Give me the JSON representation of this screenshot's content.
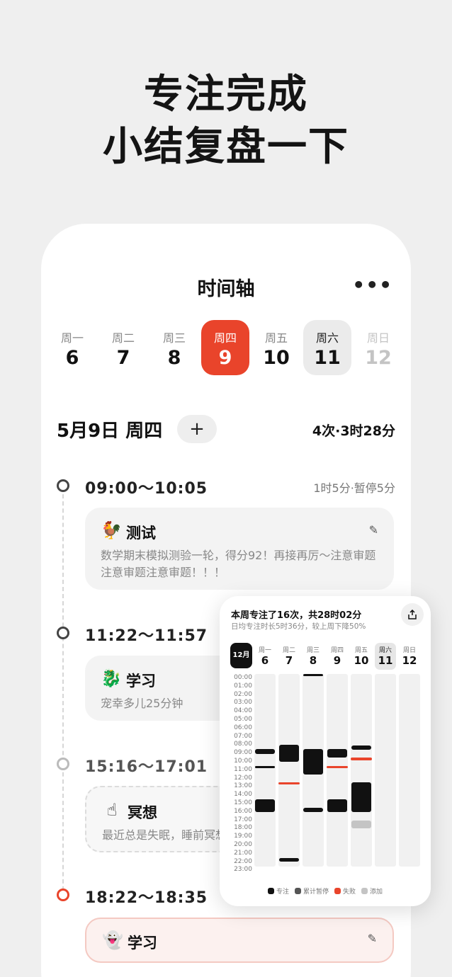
{
  "headline": {
    "line1": "专注完成",
    "line2": "小结复盘一下"
  },
  "app": {
    "title": "时间轴",
    "more": "•••"
  },
  "week": [
    {
      "name": "周一",
      "date": "6",
      "state": "normal"
    },
    {
      "name": "周二",
      "date": "7",
      "state": "normal"
    },
    {
      "name": "周三",
      "date": "8",
      "state": "normal"
    },
    {
      "name": "周四",
      "date": "9",
      "state": "active"
    },
    {
      "name": "周五",
      "date": "10",
      "state": "normal"
    },
    {
      "name": "周六",
      "date": "11",
      "state": "today"
    },
    {
      "name": "周日",
      "date": "12",
      "state": "future"
    }
  ],
  "day_header": {
    "date": "5月9日 周四",
    "add": "+",
    "summary": "4次·3时28分"
  },
  "sessions": [
    {
      "time": "09:00～10:05",
      "info": "1时5分·暂停5分",
      "title": "测试",
      "icon": "rooster-icon",
      "glyph": "🐓",
      "body": "数学期末模拟测验一轮，得分92！再接再厉～注意审题注意审题注意审题！！！",
      "edit": "✎"
    },
    {
      "time": "11:22～11:57",
      "title": "学习",
      "icon": "dragon-icon",
      "glyph": "🐉",
      "body": "宠幸多儿25分钟"
    },
    {
      "time": "15:16～17:01",
      "title": "冥想",
      "icon": "hand-icon",
      "glyph": "☝",
      "body": "最近总是失眠，睡前冥想"
    },
    {
      "time": "18:22～18:35",
      "title": "学习",
      "icon": "ghost-icon",
      "glyph": "👻",
      "body": "",
      "edit": "✎"
    }
  ],
  "weekly": {
    "title": "本周专注了16次，共28时02分",
    "subtitle": "日均专注时长5时36分，较上周下降50%",
    "share_icon": "share-icon",
    "month": "12月",
    "days": [
      {
        "name": "周一",
        "date": "6"
      },
      {
        "name": "周二",
        "date": "7"
      },
      {
        "name": "周三",
        "date": "8"
      },
      {
        "name": "周四",
        "date": "9"
      },
      {
        "name": "周五",
        "date": "10"
      },
      {
        "name": "周六",
        "date": "11",
        "selected": true
      },
      {
        "name": "周日",
        "date": "12"
      }
    ],
    "hours": [
      "00:00",
      "01:00",
      "02:00",
      "03:00",
      "04:00",
      "05:00",
      "06:00",
      "07:00",
      "08:00",
      "09:00",
      "10:00",
      "11:00",
      "12:00",
      "13:00",
      "14:00",
      "15:00",
      "16:00",
      "17:00",
      "18:00",
      "19:00",
      "20:00",
      "21:00",
      "22:00",
      "23:00"
    ],
    "legend": [
      {
        "label": "专注",
        "color": "#111111"
      },
      {
        "label": "累计暂停",
        "color": "#555555"
      },
      {
        "label": "失败",
        "color": "#e9442b"
      },
      {
        "label": "添加",
        "color": "#c4c4c4"
      }
    ],
    "colors": {
      "focus": "#111111",
      "fail": "#e9442b",
      "add": "#c4c4c4"
    }
  },
  "chart_data": {
    "type": "bar",
    "description_units": "hours of day",
    "ylim": [
      0,
      23
    ],
    "categories": [
      "6",
      "7",
      "8",
      "9",
      "10",
      "11",
      "12"
    ],
    "blocks": [
      {
        "day": "6",
        "start": 9.0,
        "end": 9.6,
        "kind": "focus"
      },
      {
        "day": "6",
        "start": 11.0,
        "end": 11.3,
        "kind": "focus"
      },
      {
        "day": "6",
        "start": 15.0,
        "end": 16.5,
        "kind": "focus"
      },
      {
        "day": "7",
        "start": 8.5,
        "end": 10.5,
        "kind": "focus"
      },
      {
        "day": "7",
        "start": 13.0,
        "end": 13.15,
        "kind": "fail"
      },
      {
        "day": "7",
        "start": 22.0,
        "end": 22.5,
        "kind": "focus"
      },
      {
        "day": "8",
        "start": 0.0,
        "end": 0.2,
        "kind": "focus"
      },
      {
        "day": "8",
        "start": 9.0,
        "end": 12.0,
        "kind": "focus"
      },
      {
        "day": "8",
        "start": 16.0,
        "end": 16.5,
        "kind": "focus"
      },
      {
        "day": "9",
        "start": 9.0,
        "end": 10.0,
        "kind": "focus"
      },
      {
        "day": "9",
        "start": 11.0,
        "end": 11.3,
        "kind": "fail"
      },
      {
        "day": "9",
        "start": 15.0,
        "end": 16.5,
        "kind": "focus"
      },
      {
        "day": "10",
        "start": 8.6,
        "end": 9.1,
        "kind": "focus"
      },
      {
        "day": "10",
        "start": 10.0,
        "end": 10.3,
        "kind": "fail"
      },
      {
        "day": "10",
        "start": 13.0,
        "end": 16.5,
        "kind": "focus"
      },
      {
        "day": "10",
        "start": 17.5,
        "end": 18.5,
        "kind": "add"
      }
    ]
  }
}
